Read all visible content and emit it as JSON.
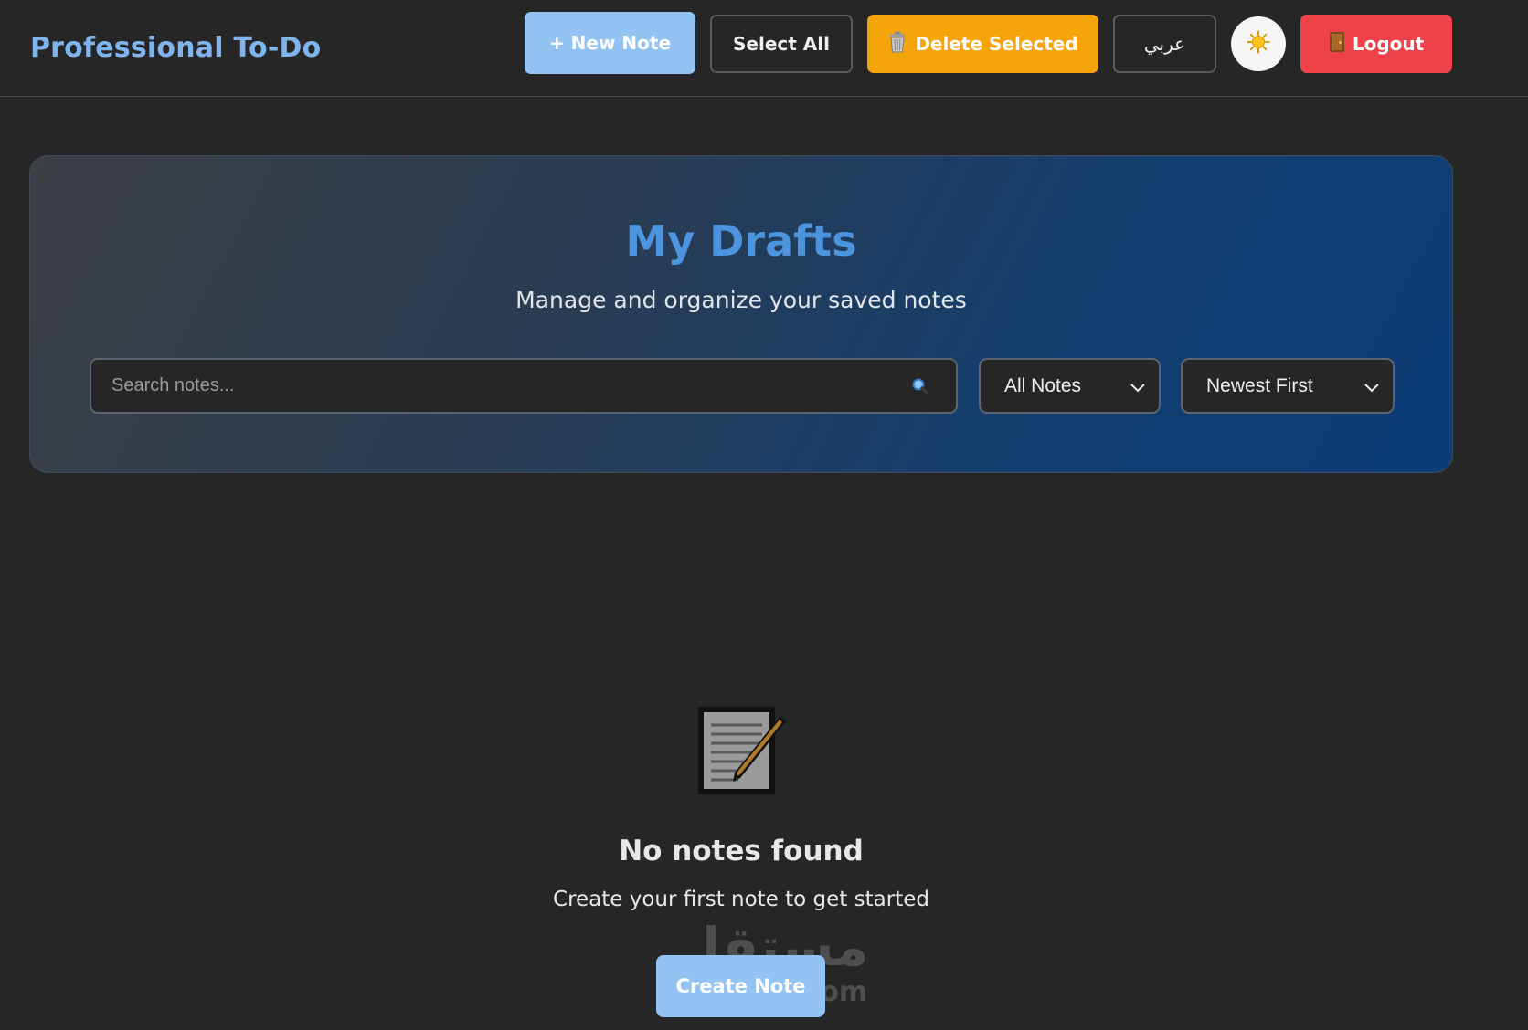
{
  "header": {
    "brand": "Professional To-Do",
    "new_note_label": "+ New Note",
    "select_all_label": "Select All",
    "delete_selected_label": "Delete Selected",
    "language_label": "عربي",
    "logout_label": "Logout",
    "icons": {
      "delete": "trash-icon",
      "theme": "sun-icon",
      "logout": "door-icon"
    }
  },
  "hero": {
    "title": "My Drafts",
    "subtitle": "Manage and organize your saved notes",
    "search_placeholder": "Search notes...",
    "filter_selected": "All Notes",
    "sort_selected": "Newest First"
  },
  "empty_state": {
    "title": "No notes found",
    "text": "Create your first note to get started",
    "button_label": "Create Note"
  },
  "watermark": {
    "arabic": "مستقل",
    "latin": "mostaql.com"
  },
  "colors": {
    "background": "#262626",
    "brand": "#7fb4ec",
    "primary": "#93c3f3",
    "warning": "#f5a40c",
    "danger": "#ee4148",
    "title_accent": "#4d94df"
  }
}
